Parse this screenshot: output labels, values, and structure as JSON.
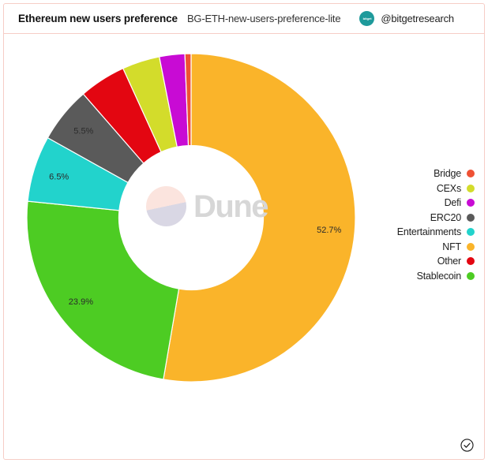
{
  "header": {
    "title": "Ethereum new users preference",
    "subtitle": "BG-ETH-new-users-preference-lite",
    "brand_logo_text": "bitget",
    "brand_handle": "@bitgetresearch",
    "logo_color": "#1e9a9b"
  },
  "watermark": {
    "text": "Dune",
    "text_color": "#d7d7d7",
    "mark_top_color": "#fbe4de",
    "mark_bottom_color": "#d9d7e4"
  },
  "legend": {
    "position": "right",
    "items": [
      {
        "label": "Bridge",
        "color": "#ef5134"
      },
      {
        "label": "CEXs",
        "color": "#d3dc2b"
      },
      {
        "label": "Defi",
        "color": "#c80bd4"
      },
      {
        "label": "ERC20",
        "color": "#5a5a5a"
      },
      {
        "label": "Entertainments",
        "color": "#22d3cc"
      },
      {
        "label": "NFT",
        "color": "#fab42a"
      },
      {
        "label": "Other",
        "color": "#e30611"
      },
      {
        "label": "Stablecoin",
        "color": "#4dcc23"
      }
    ]
  },
  "footer": {
    "verified_icon": "check-circle-icon"
  },
  "chart_data": {
    "type": "pie",
    "variant": "donut",
    "title": "Ethereum new users preference",
    "subtitle": "BG-ETH-new-users-preference-lite",
    "start_angle_deg": 0,
    "direction": "clockwise",
    "inner_radius_ratio": 0.44,
    "legend_position": "right",
    "grid": false,
    "value_unit": "percent",
    "labels_shown": [
      "NFT",
      "Stablecoin",
      "Entertainments",
      "ERC20"
    ],
    "categories": [
      "NFT",
      "Stablecoin",
      "Entertainments",
      "ERC20",
      "Other",
      "CEXs",
      "Defi",
      "Bridge"
    ],
    "values": [
      52.7,
      23.9,
      6.5,
      5.5,
      4.6,
      3.7,
      2.5,
      0.6
    ],
    "slices": [
      {
        "name": "NFT",
        "value": 52.7,
        "label": "52.7%",
        "color": "#fab42a",
        "show_label": true
      },
      {
        "name": "Stablecoin",
        "value": 23.9,
        "label": "23.9%",
        "color": "#4dcc23",
        "show_label": true
      },
      {
        "name": "Entertainments",
        "value": 6.5,
        "label": "6.5%",
        "color": "#22d3cc",
        "show_label": true
      },
      {
        "name": "ERC20",
        "value": 5.5,
        "label": "5.5%",
        "color": "#5a5a5a",
        "show_label": true
      },
      {
        "name": "Other",
        "value": 4.6,
        "label": "4.6%",
        "color": "#e30611",
        "show_label": false
      },
      {
        "name": "CEXs",
        "value": 3.7,
        "label": "3.7%",
        "color": "#d3dc2b",
        "show_label": false
      },
      {
        "name": "Defi",
        "value": 2.5,
        "label": "2.5%",
        "color": "#c80bd4",
        "show_label": false
      },
      {
        "name": "Bridge",
        "value": 0.6,
        "label": "0.6%",
        "color": "#ef5134",
        "show_label": false
      }
    ]
  }
}
